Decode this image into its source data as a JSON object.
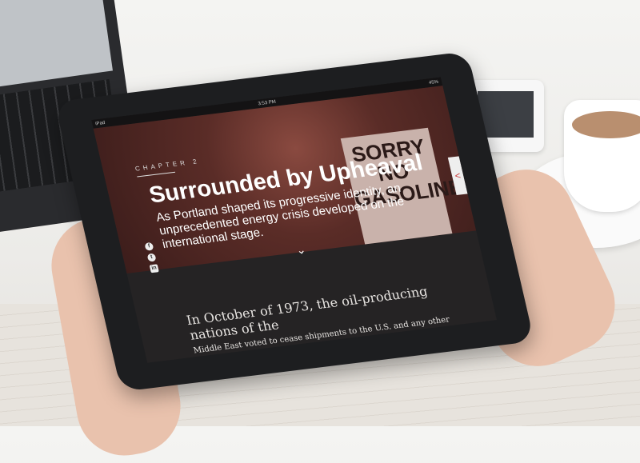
{
  "status_bar": {
    "device": "iPad",
    "time": "3:53 PM",
    "battery": "45%"
  },
  "hero": {
    "chapter_label": "CHAPTER 2",
    "title": "Surrounded by Upheaval",
    "subtitle": "As Portland shaped its progressive identity, an unprecedented energy crisis developed on the international stage.",
    "photo_sign_text": "SORRY NO GASOLINE",
    "social_icons": [
      "facebook-icon",
      "twitter-icon",
      "linkedin-icon"
    ],
    "social_glyphs": {
      "facebook": "f",
      "twitter": "t",
      "linkedin": "in"
    },
    "side_tab_glyph": "<",
    "scroll_glyph": "⌄"
  },
  "article": {
    "lead": "In October of 1973, the oil-producing nations of the",
    "paragraph": "Middle East voted to cease shipments to the U.S. and any other country that supported Israel in its conflict with Palestine. As President Nixon worked to"
  },
  "colors": {
    "hero_tint": "#5a2c27",
    "article_bg": "#252324",
    "accent": "#cc3333"
  }
}
